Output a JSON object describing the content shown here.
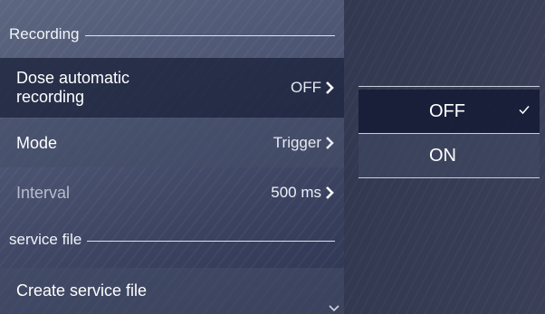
{
  "settings": {
    "recording_header": "Recording",
    "rows": [
      {
        "label": "Dose automatic recording",
        "value": "OFF"
      },
      {
        "label": "Mode",
        "value": "Trigger"
      },
      {
        "label": "Interval",
        "value": "500 ms"
      }
    ],
    "service_header": "service file",
    "create_service_file": "Create service file"
  },
  "dropdown": {
    "options": [
      {
        "label": "OFF",
        "selected": true
      },
      {
        "label": "ON",
        "selected": false
      }
    ]
  },
  "icons": {
    "row_arrow": "chevron-right-icon",
    "selected_mark": "check-icon",
    "scroll_more": "chevron-down-icon"
  },
  "colors": {
    "selected_row": "#181e38",
    "panel_bg": "#4d5673",
    "screen_bg": "#2c3148",
    "divider": "#c9cedb"
  }
}
